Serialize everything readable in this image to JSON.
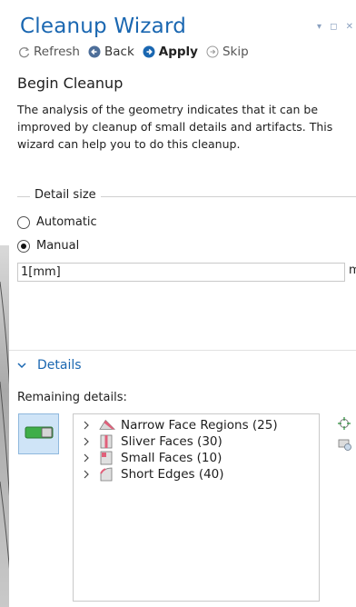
{
  "panel": {
    "title": "Cleanup Wizard",
    "window_controls": "▾ ◻ ✕"
  },
  "toolbar": {
    "refresh": "Refresh",
    "back": "Back",
    "apply": "Apply",
    "skip": "Skip"
  },
  "begin": {
    "heading": "Begin Cleanup",
    "description": "The analysis of the geometry indicates that it can be improved by cleanup of small details and artifacts. This wizard can help you to do this cleanup."
  },
  "detail_size": {
    "label": "Detail size",
    "options": [
      "Automatic",
      "Manual"
    ],
    "selected": "Manual",
    "value": "1[mm]",
    "unit": "m"
  },
  "details": {
    "header": "Details",
    "remaining_label": "Remaining details:",
    "items": [
      {
        "label": "Narrow Face Regions (25)",
        "icon": "narrow-face-icon"
      },
      {
        "label": "Sliver Faces (30)",
        "icon": "sliver-face-icon"
      },
      {
        "label": "Small Faces (10)",
        "icon": "small-face-icon"
      },
      {
        "label": "Short Edges (40)",
        "icon": "short-edge-icon"
      }
    ]
  },
  "colors": {
    "accent": "#1a67b1",
    "toggle_bg": "#cfe4f7",
    "toggle_green": "#3fae49"
  }
}
